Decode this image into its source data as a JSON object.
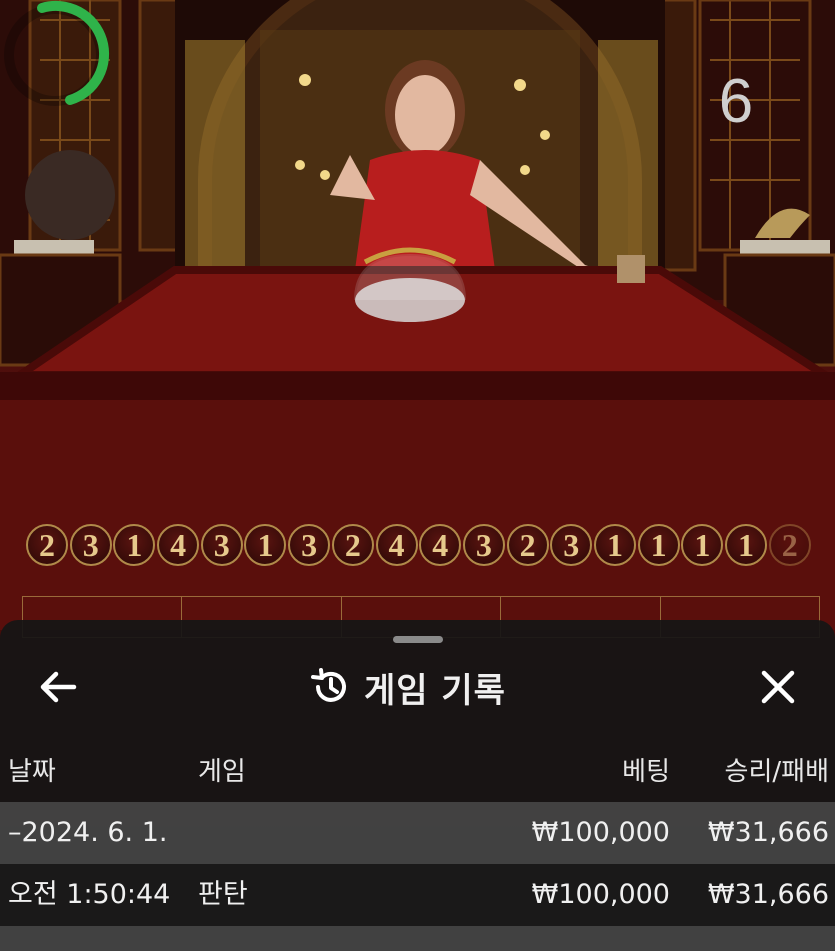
{
  "timer": {
    "countdown": "6",
    "ring_color": "#2fb34a"
  },
  "road": {
    "beads": [
      "2",
      "3",
      "1",
      "4",
      "3",
      "1",
      "3",
      "2",
      "4",
      "4",
      "3",
      "2",
      "3",
      "1",
      "1",
      "1",
      "1",
      "2"
    ]
  },
  "sheet": {
    "title": "게임 기록",
    "back_icon": "arrow-left-icon",
    "history_icon": "history-icon",
    "close_icon": "close-icon",
    "columns": {
      "date": "날짜",
      "game": "게임",
      "bet": "베팅",
      "win": "승리/패배"
    },
    "rows": [
      {
        "date": "–2024. 6. 1.",
        "game": "",
        "bet": "₩100,000",
        "win": "₩31,666"
      },
      {
        "date": "오전 1:50:44",
        "game": "판탄",
        "bet": "₩100,000",
        "win": "₩31,666"
      }
    ]
  },
  "colors": {
    "felt": "#7a1410",
    "sheet_bg": "#161616",
    "bead_gold": "#e6c98c"
  }
}
